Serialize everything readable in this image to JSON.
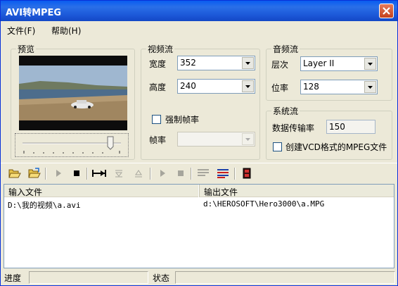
{
  "window": {
    "title": "AVI转MPEG"
  },
  "menu": {
    "file": "文件(F)",
    "help": "帮助(H)"
  },
  "preview": {
    "legend": "预览"
  },
  "video_stream": {
    "legend": "视频流",
    "width_label": "宽度",
    "width_value": "352",
    "height_label": "高度",
    "height_value": "240",
    "force_fps_label": "强制帧率",
    "fps_label": "帧率",
    "fps_value": ""
  },
  "audio_stream": {
    "legend": "音频流",
    "layer_label": "层次",
    "layer_value": "Layer II",
    "bitrate_label": "位率",
    "bitrate_value": "128"
  },
  "system_stream": {
    "legend": "系统流",
    "rate_label": "数据传输率",
    "rate_value": "150",
    "vcd_label": "创建VCD格式的MPEG文件"
  },
  "list": {
    "col_input": "输入文件",
    "col_output": "输出文件",
    "rows": [
      {
        "input": "D:\\我的视频\\a.avi",
        "output": "d:\\HEROSOFT\\Hero3000\\a.MPG"
      }
    ]
  },
  "status": {
    "progress_label": "进度",
    "status_label": "状态"
  }
}
